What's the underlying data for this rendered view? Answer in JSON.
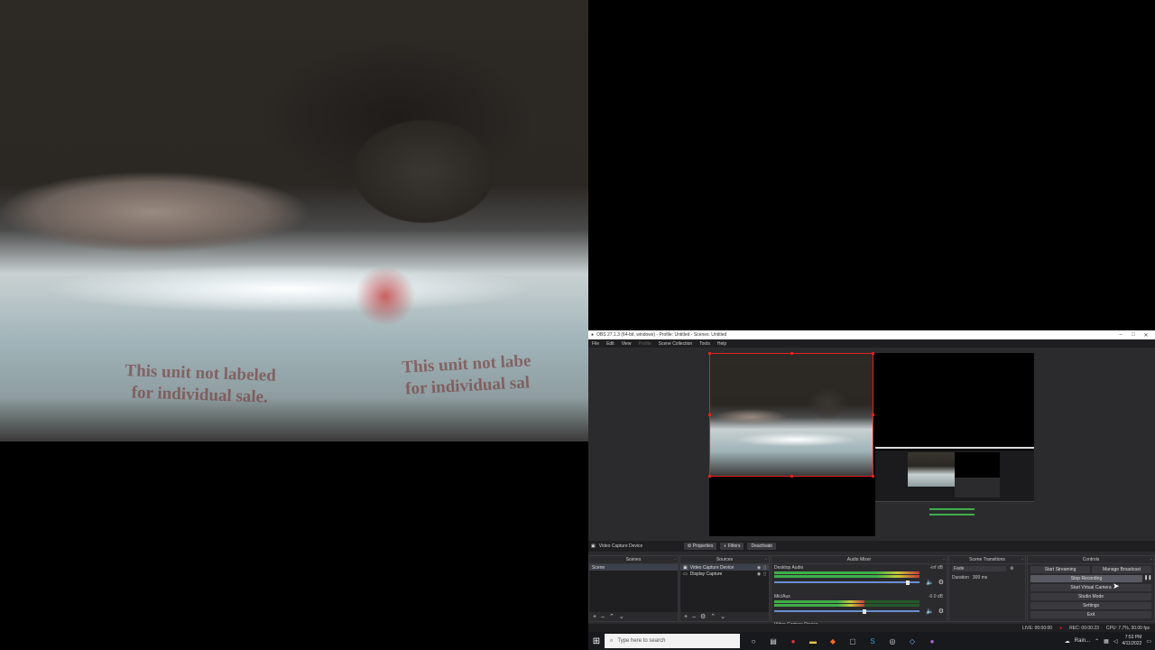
{
  "webcam": {
    "package_text_left": [
      "This unit not labeled",
      "for individual sale."
    ],
    "package_text_right": [
      "This unit not labe",
      "for individual sal"
    ]
  },
  "obs": {
    "window_title": "OBS 27.1.3 (64-bit, windows) - Profile: Untitled - Scenes: Untitled",
    "window_controls": [
      "–",
      "□",
      "✕"
    ],
    "menu": [
      "File",
      "Edit",
      "View",
      "Profile",
      "Scene Collection",
      "Tools",
      "Help"
    ],
    "source_toolbar": {
      "selected_source": "Video Capture Device",
      "properties": "Properties",
      "filters": "Filters",
      "deactivate": "Deactivate"
    },
    "scenes": {
      "title": "Scenes",
      "items": [
        "Scene"
      ]
    },
    "sources": {
      "title": "Sources",
      "items": [
        "Video Capture Device",
        "Display Capture"
      ]
    },
    "audio_mixer": {
      "title": "Audio Mixer",
      "channels": [
        {
          "name": "Desktop Audio",
          "db": "-inf dB",
          "volume": 0.92
        },
        {
          "name": "Mic/Aux",
          "db": "-6.0 dB",
          "volume": 0.62
        }
      ],
      "extra_channel": "Video Capture Device"
    },
    "scene_transitions": {
      "title": "Scene Transitions",
      "transition": "Fade",
      "duration_label": "Duration",
      "duration_value": "300 ms"
    },
    "controls": {
      "title": "Controls",
      "start_streaming": "Start Streaming",
      "manage_broadcast": "Manage Broadcast",
      "stop_recording": "Stop Recording",
      "start_virtual_camera": "Start Virtual Camera",
      "studio_mode": "Studio Mode",
      "settings": "Settings",
      "exit": "Exit"
    },
    "status": {
      "live": "LIVE: 00:00:00",
      "rec": "REC: 00:00:23",
      "cpu": "CPU: 7.7%, 30.00 fps"
    },
    "dock_footer_icons": [
      "+",
      "–",
      "⌃",
      "⌄"
    ],
    "sources_footer_icons": [
      "+",
      "–",
      "⚙",
      "⌃",
      "⌄"
    ]
  },
  "taskbar": {
    "search_placeholder": "Type here to search",
    "tray_weather": "Rain...",
    "time": "7:53 PM",
    "date": "4/11/2022"
  },
  "colors": {
    "obs_bg": "#2b2b2e",
    "panel_dark": "#1f1f21",
    "selection_red": "#e02020",
    "meter_green": "#3fae49",
    "taskbar": "#18191c"
  }
}
